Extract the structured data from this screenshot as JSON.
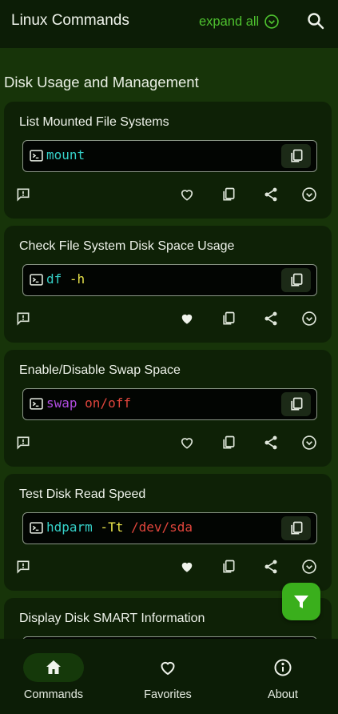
{
  "appbar": {
    "title": "Linux Commands",
    "expand_label": "expand all"
  },
  "section": {
    "title": "Disk Usage and Management"
  },
  "colors": {
    "accent": "#4ec22f",
    "cmd_cyan": "#35d0c8",
    "cmd_yellow": "#e8e34a",
    "cmd_red": "#e0453c",
    "cmd_purple": "#b04ce0"
  },
  "cards": [
    {
      "title": "List Mounted File Systems",
      "tokens": [
        {
          "text": "mount",
          "color": "#35d0c8"
        }
      ],
      "favorited": false
    },
    {
      "title": "Check File System Disk Space Usage",
      "tokens": [
        {
          "text": "df",
          "color": "#35d0c8"
        },
        {
          "text": " -h",
          "color": "#e8e34a"
        }
      ],
      "favorited": true
    },
    {
      "title": "Enable/Disable Swap Space",
      "tokens": [
        {
          "text": "swap",
          "color": "#b04ce0"
        },
        {
          "text": " on/off",
          "color": "#e0453c"
        }
      ],
      "favorited": false
    },
    {
      "title": "Test Disk Read Speed",
      "tokens": [
        {
          "text": "hdparm",
          "color": "#35d0c8"
        },
        {
          "text": " -Tt",
          "color": "#e8e34a"
        },
        {
          "text": " /dev/sda",
          "color": "#e0453c"
        }
      ],
      "favorited": true
    },
    {
      "title": "Display Disk SMART Information",
      "tokens": [],
      "favorited": false
    }
  ],
  "nav": {
    "items": [
      {
        "label": "Commands",
        "icon": "home-icon",
        "active": true
      },
      {
        "label": "Favorites",
        "icon": "heart-icon",
        "active": false
      },
      {
        "label": "About",
        "icon": "info-icon",
        "active": false
      }
    ]
  }
}
